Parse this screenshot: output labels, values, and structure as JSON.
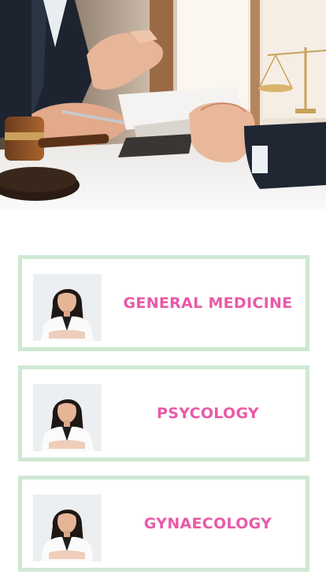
{
  "hero": {
    "image": "lawyer-consultation-photo"
  },
  "specialties": [
    {
      "label": "GENERAL MEDICINE",
      "photo": "female-doctor-portrait"
    },
    {
      "label": "PSYCOLOGY",
      "photo": "female-doctor-portrait"
    },
    {
      "label": "GYNAECOLOGY",
      "photo": "female-doctor-portrait"
    }
  ],
  "colors": {
    "label": "#e85aa8",
    "card_border": "#cfe8d3",
    "background": "#ffffff"
  }
}
